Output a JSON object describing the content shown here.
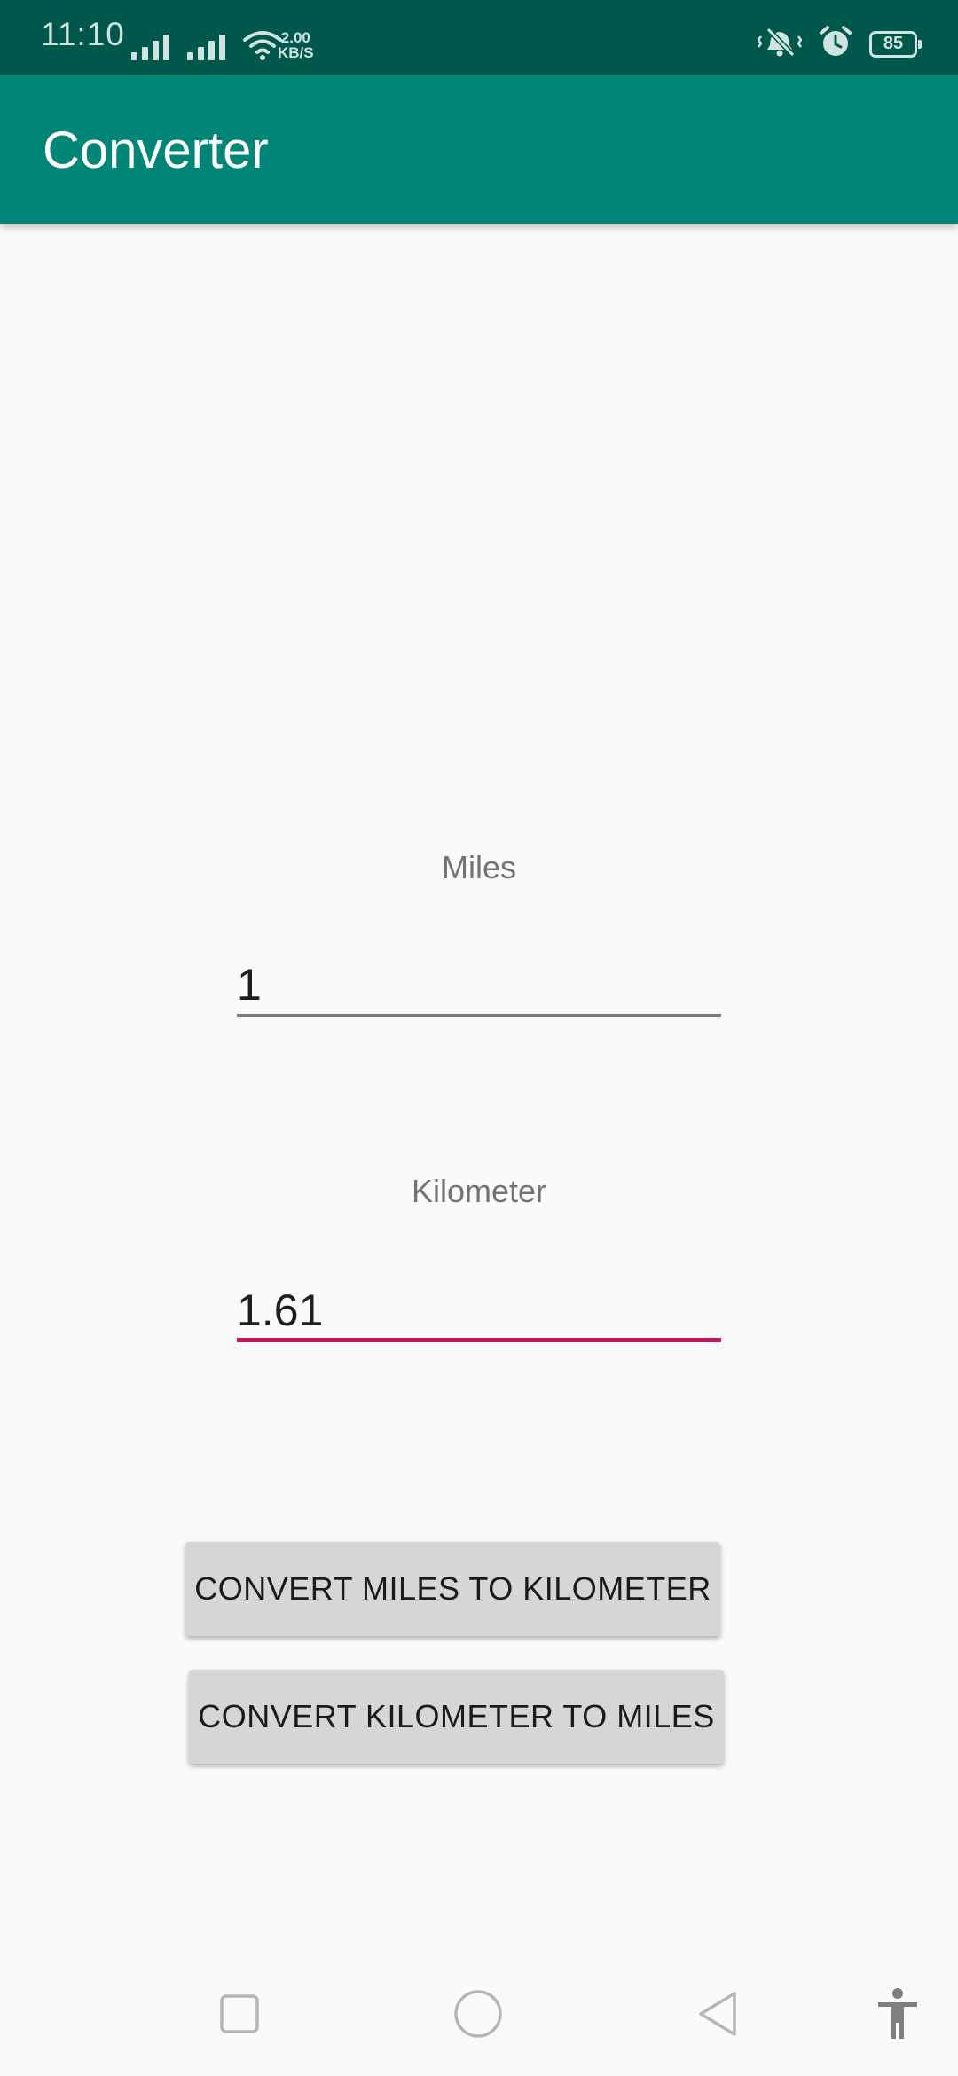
{
  "status_bar": {
    "time": "11:10",
    "net_speed_value": "2.00",
    "net_speed_unit": "KB/S",
    "battery_level": "85",
    "icons": [
      "signal-icon",
      "signal-icon",
      "wifi-icon",
      "vibrate-icon",
      "alarm-icon",
      "battery-icon"
    ]
  },
  "app_bar": {
    "title": "Converter",
    "color": "#008577"
  },
  "form": {
    "miles_label": "Miles",
    "miles_value": "1",
    "kilometer_label": "Kilometer",
    "kilometer_value": "1.61",
    "accent_color": "#c2185b"
  },
  "buttons": {
    "miles_to_km": "CONVERT MILES TO KILOMETER",
    "km_to_miles": "CONVERT KILOMETER TO MILES"
  },
  "nav_bar": {
    "icons": [
      "recents-square-icon",
      "home-circle-icon",
      "back-triangle-icon",
      "accessibility-icon"
    ]
  }
}
